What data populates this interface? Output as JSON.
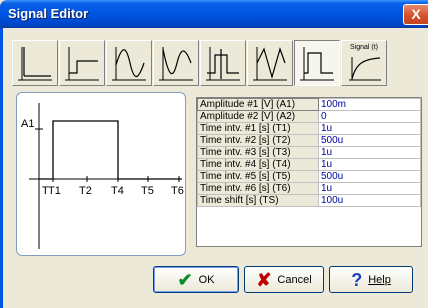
{
  "window": {
    "title": "Signal Editor",
    "close_glyph": "X"
  },
  "toolbar": {
    "buttons": [
      {
        "icon": "step-up-icon"
      },
      {
        "icon": "ramp-step-icon"
      },
      {
        "icon": "sine-positive-icon"
      },
      {
        "icon": "sine-negative-icon"
      },
      {
        "icon": "pulse-train-icon"
      },
      {
        "icon": "triangle-wave-icon"
      },
      {
        "icon": "pulse-icon",
        "active": true
      },
      {
        "icon": "signal-t-icon",
        "label": "Signal (t)"
      }
    ]
  },
  "preview": {
    "axis_label": "A1",
    "tick_labels": [
      "T",
      "T1",
      "T2",
      "T4",
      "T5",
      "T6"
    ]
  },
  "params": [
    {
      "name": "Amplitude #1 [V] (A1)",
      "value": "100m"
    },
    {
      "name": "Amplitude #2 [V] (A2)",
      "value": "0"
    },
    {
      "name": "Time intv. #1 [s] (T1)",
      "value": "1u"
    },
    {
      "name": "Time intv. #2 [s] (T2)",
      "value": "500u"
    },
    {
      "name": "Time intv. #3 [s] (T3)",
      "value": "1u"
    },
    {
      "name": "Time intv. #4 [s] (T4)",
      "value": "1u"
    },
    {
      "name": "Time intv. #5 [s] (T5)",
      "value": "500u"
    },
    {
      "name": "Time intv. #6 [s] (T6)",
      "value": "1u"
    },
    {
      "name": "Time shift [s] (TS)",
      "value": "100u"
    }
  ],
  "buttons": {
    "ok": {
      "label": "OK",
      "icon": "check-icon"
    },
    "cancel": {
      "label": "Cancel",
      "icon": "x-icon"
    },
    "help": {
      "label": "Help",
      "icon": "question-icon"
    }
  },
  "colors": {
    "titlebar": "#0054e3",
    "ok_check": "#0a8f2a",
    "cancel_x": "#c00000",
    "help_q": "#1b3fbf",
    "value_text": "#0000a0"
  }
}
